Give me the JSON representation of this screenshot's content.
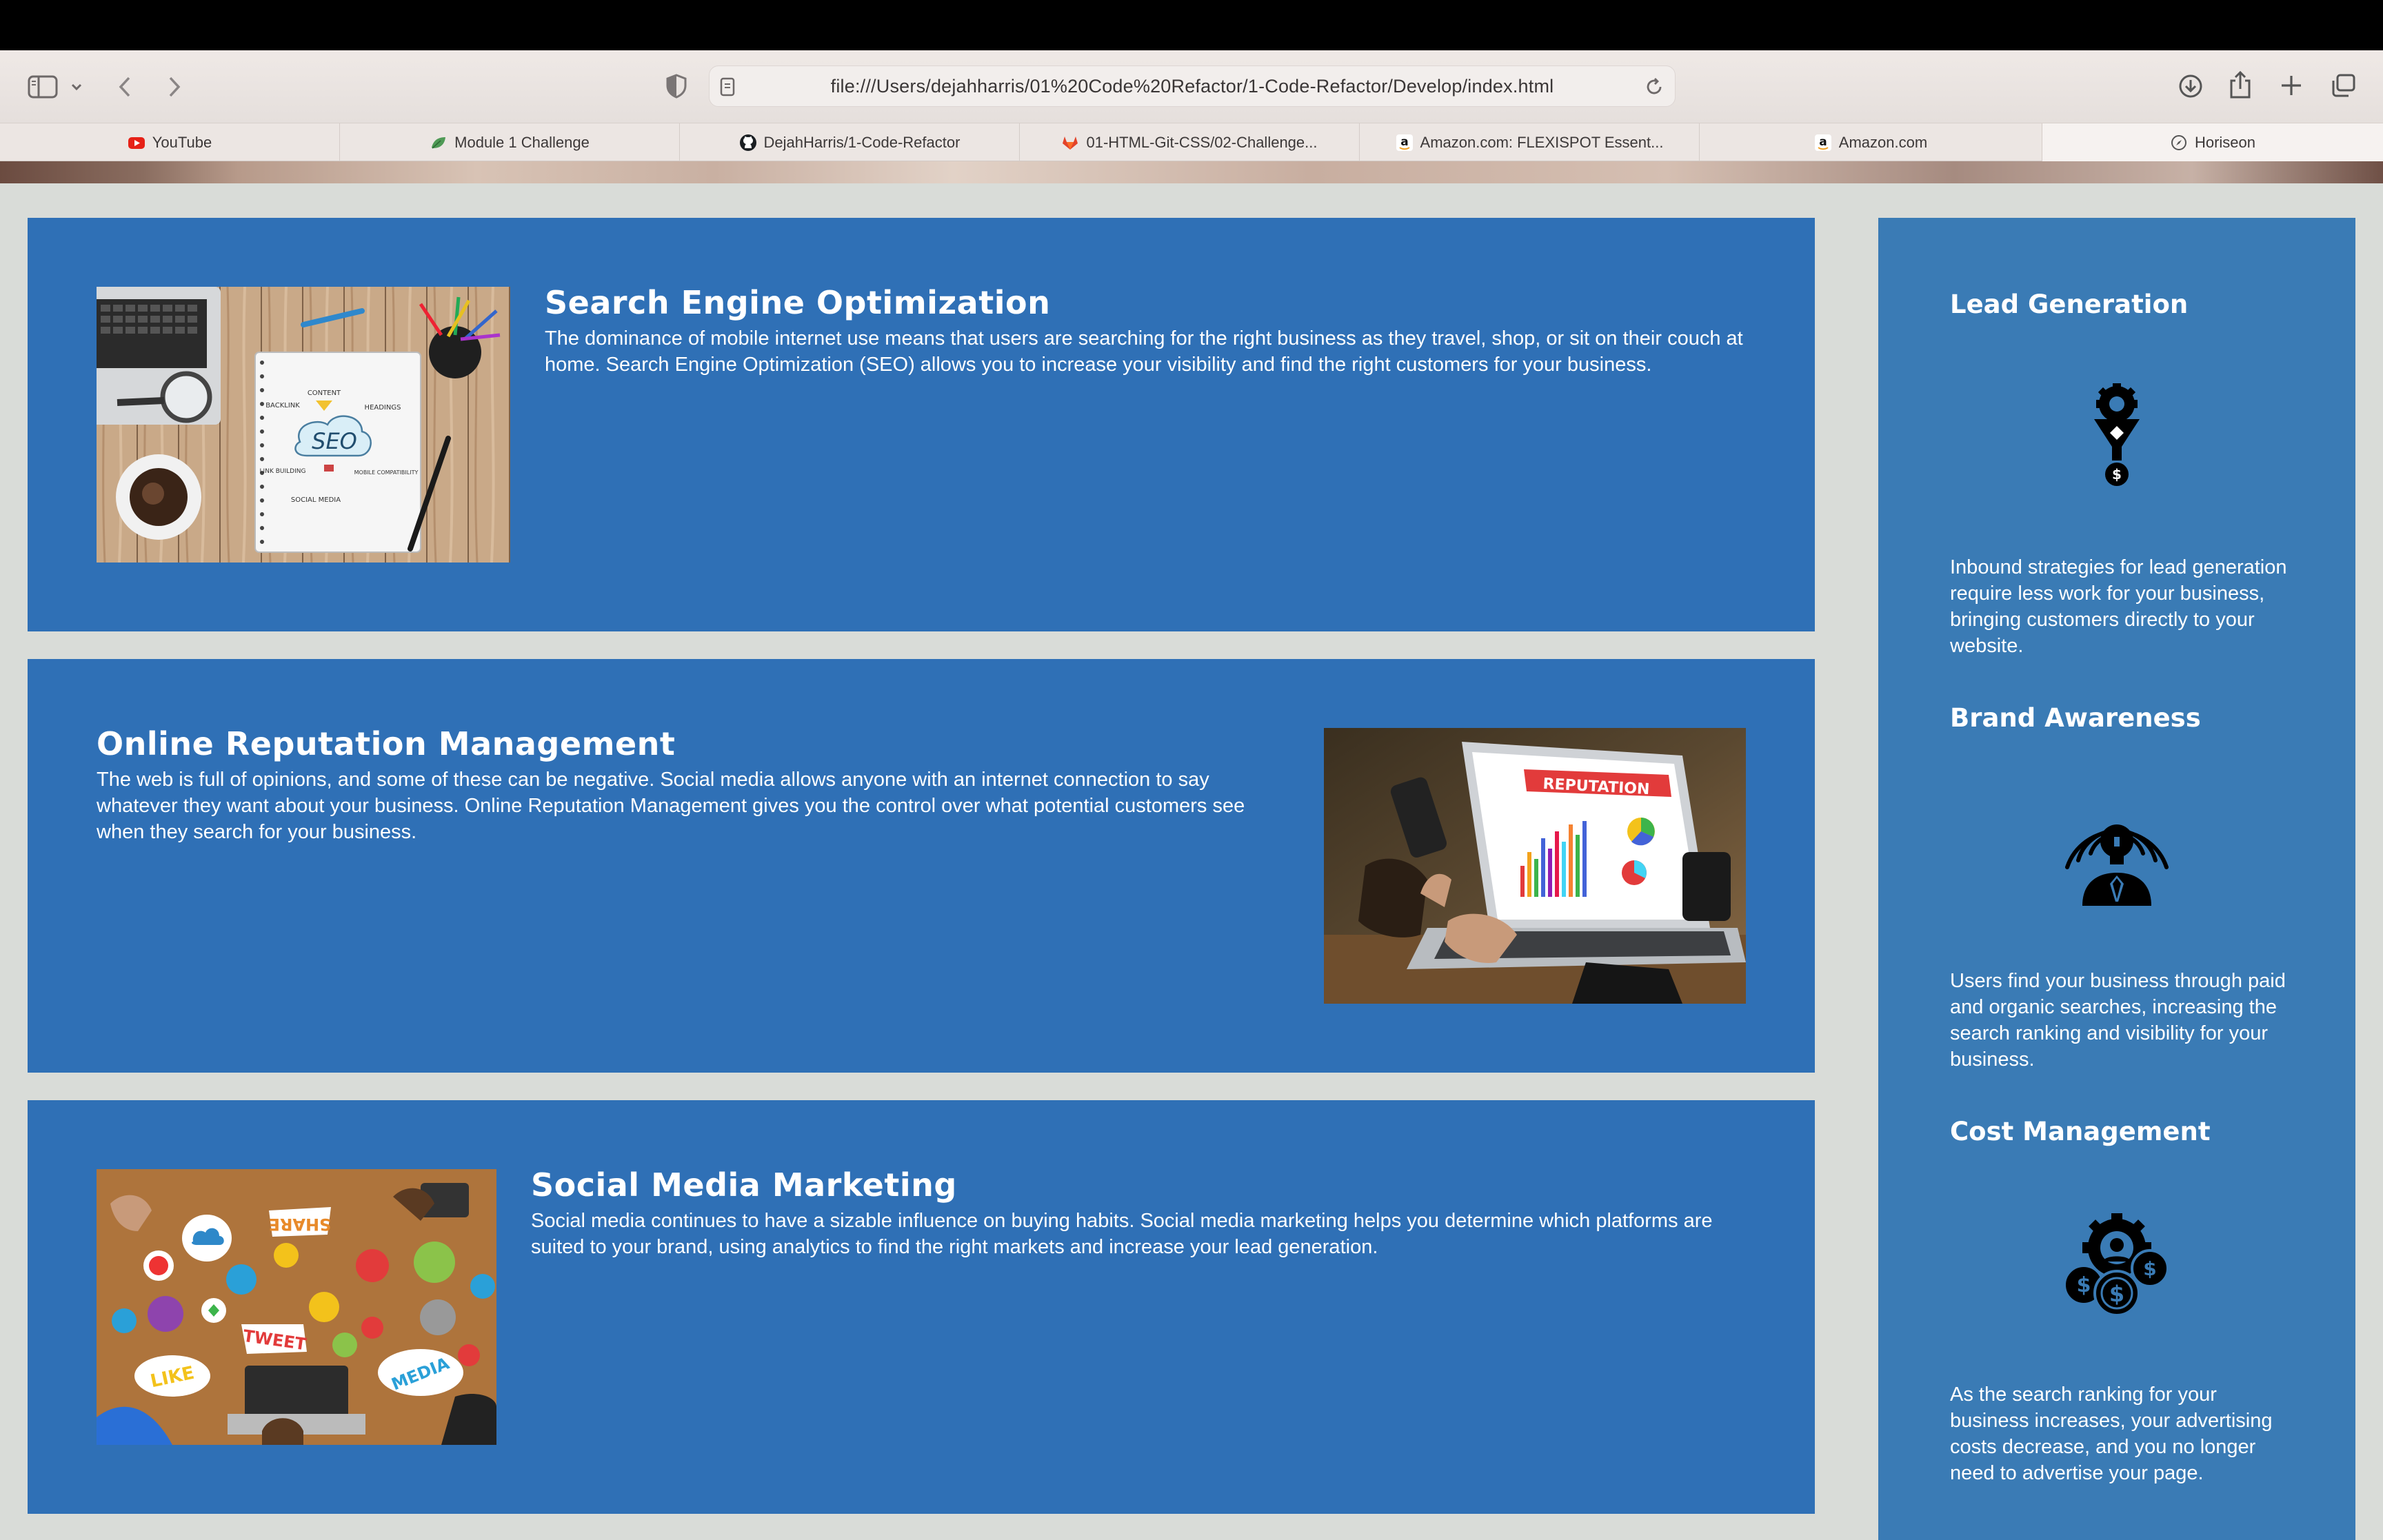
{
  "browser": {
    "url": "file:///Users/dejahharris/01%20Code%20Refactor/1-Code-Refactor/Develop/index.html",
    "tabs": [
      {
        "label": "YouTube",
        "icon": "youtube-icon"
      },
      {
        "label": "Module 1 Challenge",
        "icon": "leaf-icon"
      },
      {
        "label": "DejahHarris/1-Code-Refactor",
        "icon": "github-icon"
      },
      {
        "label": "01-HTML-Git-CSS/02-Challenge...",
        "icon": "gitlab-icon"
      },
      {
        "label": "Amazon.com: FLEXISPOT Essent...",
        "icon": "amazon-icon"
      },
      {
        "label": "Amazon.com",
        "icon": "amazon-icon"
      },
      {
        "label": "Horiseon",
        "icon": "compass-icon",
        "active": true
      }
    ]
  },
  "services": [
    {
      "title": "Search Engine Optimization",
      "text": "The dominance of mobile internet use means that users are searching for the right business as they travel, shop, or sit on their couch at home. Search Engine Optimization (SEO) allows you to increase your visibility and find the right customers for your business.",
      "image_labels": {
        "center": "SEO",
        "l1": "CONTENT",
        "l2": "BACKLINK",
        "l3": "HEADINGS",
        "l4": "LINK BUILDING",
        "l5": "MOBILE COMPATIBILITY",
        "l6": "SOCIAL MEDIA"
      }
    },
    {
      "title": "Online Reputation Management",
      "text": "The web is full of opinions, and some of these can be negative. Social media allows anyone with an internet connection to say whatever they want about your business. Online Reputation Management gives you the control over what potential customers see when they search for your business.",
      "image_labels": {
        "banner": "REPUTATION"
      }
    },
    {
      "title": "Social Media Marketing",
      "text": "Social media continues to have a sizable influence on buying habits. Social media marketing helps you determine which platforms are suited to your brand, using analytics to find the right markets and increase your lead generation.",
      "image_labels": {
        "share": "SHARE",
        "tweet": "TWEET",
        "like": "LIKE",
        "media": "MEDIA"
      }
    }
  ],
  "benefits": [
    {
      "title": "Lead Generation",
      "icon": "lead-generation-icon",
      "text": "Inbound strategies for lead generation require less work for your business, bringing customers directly to your website."
    },
    {
      "title": "Brand Awareness",
      "icon": "brand-awareness-icon",
      "text": "Users find your business through paid and organic searches, increasing the search ranking and visibility for your business."
    },
    {
      "title": "Cost Management",
      "icon": "cost-management-icon",
      "text": "As the search ranking for your business increases, your advertising costs decrease, and you no longer need to advertise your page."
    }
  ]
}
